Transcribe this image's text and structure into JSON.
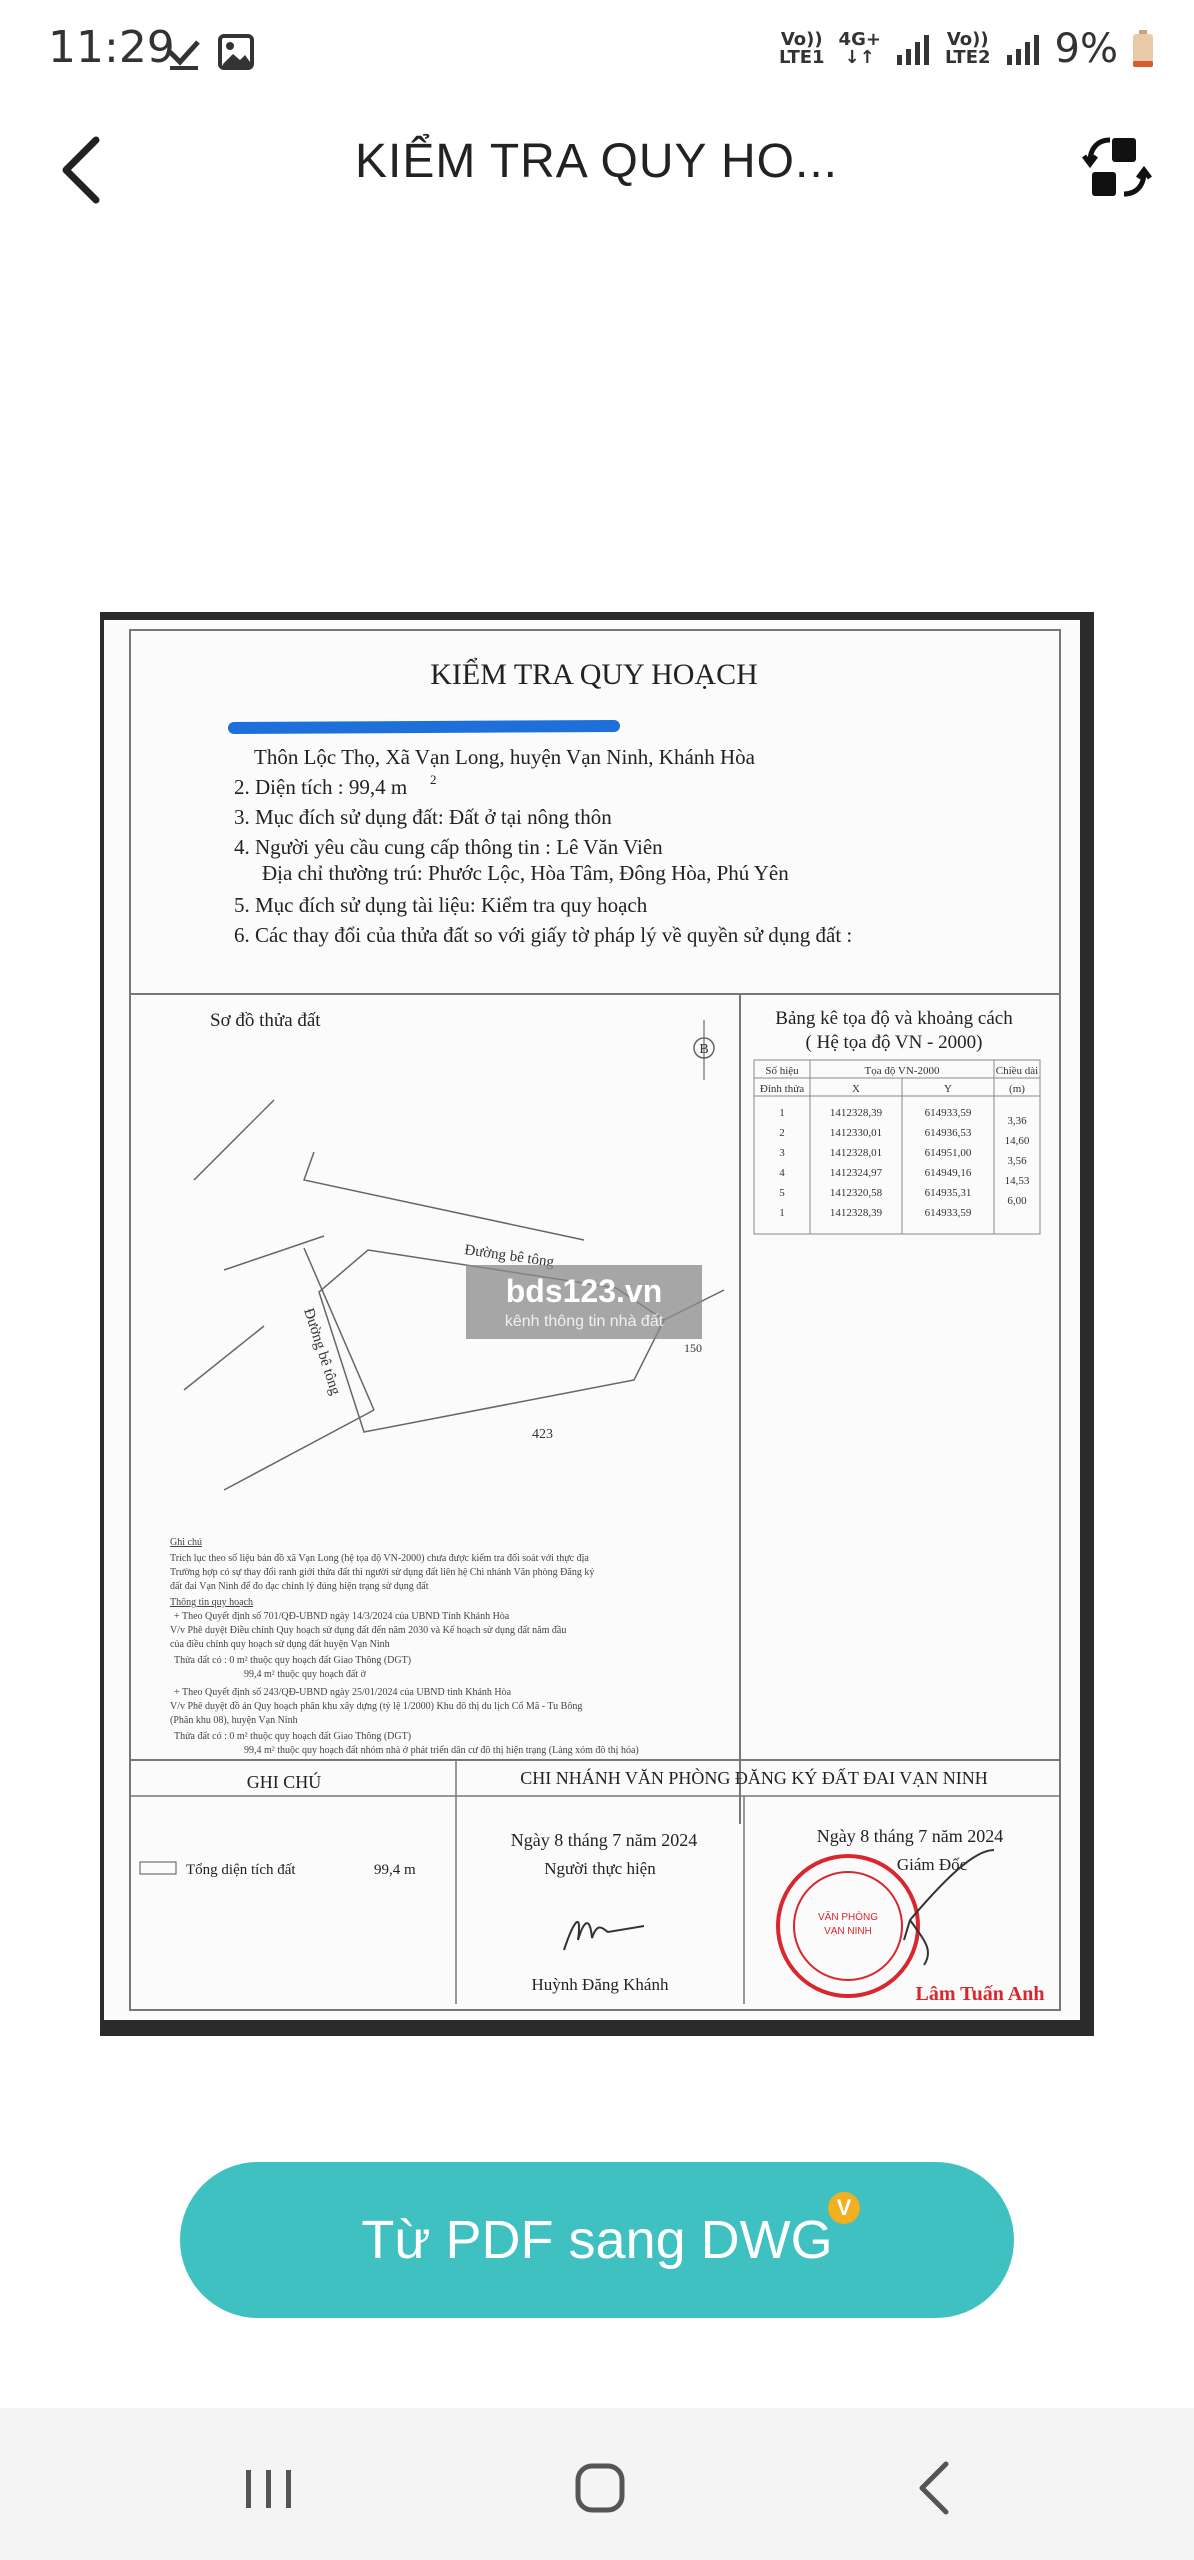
{
  "status_bar": {
    "time": "11:29",
    "net1_top": "Vo))",
    "net1_bottom": "LTE1",
    "net_4g_top": "4G+",
    "net_4g_bottom": "↓↑",
    "net2_top": "Vo))",
    "net2_bottom": "LTE2",
    "battery": "9%"
  },
  "app_bar": {
    "title": "KIỂM TRA QUY HO...",
    "back_icon": "arrow-left",
    "swap_icon": "convert-swap"
  },
  "document": {
    "heading": "KIỂM TRA QUY HOẠCH",
    "lines": [
      "Thôn Lộc Thọ, Xã Vạn Long, huyện Vạn Ninh, Khánh Hòa",
      "2. Diện tích :  99,4 m",
      "3. Mục đích sử dụng đất:  Đất ở tại nông thôn",
      "4. Người yêu cầu cung cấp thông tin : Lê Văn Viên",
      "Địa chỉ thường trú: Phước Lộc, Hòa Tâm, Đông Hòa, Phú Yên",
      "5. Mục đích sử dụng tài liệu: Kiểm tra quy hoạch",
      "6. Các thay đổi của thửa đất so với giấy tờ pháp lý về quyền sử dụng đất :"
    ],
    "area_superscript": "2",
    "map_title": "Sơ đồ thửa đất",
    "north_label": "B",
    "road_label_1": "Đường bê tông",
    "road_label_2": "Đường bê tông",
    "parcel_label": "423",
    "parcel_label_2": "150",
    "watermark_main": "bds123.vn",
    "watermark_sub": "kênh thông tin nhà đất",
    "table_title_1": "Bảng kê tọa độ và khoảng cách",
    "table_title_2": "( Hệ tọa độ VN - 2000)",
    "table_headers": [
      "Số hiệu",
      "Tọa độ VN-2000",
      "Chiều dài",
      "Đỉnh thửa",
      "X",
      "Y",
      "(m)"
    ],
    "table_rows": [
      [
        "1",
        "1412328,39",
        "614933,59",
        "3,36"
      ],
      [
        "2",
        "1412330,01",
        "614936,53",
        "14,60"
      ],
      [
        "3",
        "1412328,01",
        "614951,00",
        "3,56"
      ],
      [
        "4",
        "1412324,97",
        "614949,16",
        "14,53"
      ],
      [
        "5",
        "1412320,58",
        "614935,31",
        "6,00"
      ],
      [
        "1",
        "1412328,39",
        "614933,59",
        ""
      ]
    ],
    "notes": [
      "Ghi chú",
      "Trích lục theo số liệu bản đồ xã Vạn Long (hệ tọa độ VN-2000) chưa được kiểm tra đối soát với thực địa",
      "Trường hợp có sự thay đổi ranh giới thửa đất thì người sử dụng đất liên hệ Chi nhánh Văn phòng Đăng ký",
      "đất đai Vạn Ninh để đo đạc chỉnh lý đúng hiện trạng sử dụng đất",
      "Thông tin quy hoạch",
      "+ Theo Quyết định số  701/QĐ-UBND ngày 14/3/2024 của UBND Tỉnh Khánh Hòa",
      "V/v Phê duyệt Điều chỉnh Quy hoạch sử dụng đất đến năm 2030 và Kế hoạch sử dụng đất năm đầu",
      "của điều chỉnh quy hoạch sử dụng đất huyện Vạn Ninh",
      "Thửa đất có :      0 m² thuộc quy hoạch đất Giao Thông  (DGT)",
      "99,4 m²  thuộc quy hoạch đất ở",
      "+ Theo Quyết định số  243/QĐ-UBND ngày 25/01/2024 của UBND tỉnh Khánh Hòa",
      "V/v Phê duyệt đồ án Quy hoạch phân khu xây dựng (tỷ lệ 1/2000) Khu đô thị du lịch Cổ Mã - Tu Bông",
      "(Phân khu 08), huyện Vạn Ninh",
      "Thửa đất có :      0 m² thuộc quy hoạch đất Giao Thông  (DGT)",
      "99,4 m²  thuộc quy hoạch đất nhóm nhà ở phát triển dân cư đô thị hiện trạng (Làng xóm đô thị hóa)"
    ],
    "ghi_chu_label": "GHI CHÚ",
    "office_header": "CHI NHÁNH VĂN PHÒNG ĐĂNG KÝ ĐẤT ĐAI VẠN NINH",
    "total_area_label": "Tổng diện tích đất",
    "total_area_value": "99,4 m",
    "date_left": "Ngày  8  tháng  7  năm  2024",
    "role_left": "Người thực hiện",
    "name_left": "Huỳnh Đăng Khánh",
    "date_right": "Ngày  8  tháng  7  năm  2024",
    "role_right": "Giám Đốc",
    "name_right": "Lâm Tuấn Anh",
    "stamp_text": "CHI NHÁNH VĂN PHÒNG ĐĂNG KÝ ĐẤT ĐAI TẠI HUYỆN VẠN NINH"
  },
  "cta": {
    "label": "Từ PDF sang DWG",
    "badge": "V"
  },
  "nav_bar": {
    "recents_icon": "recents",
    "home_icon": "home",
    "back_icon": "back"
  },
  "colors": {
    "accent": "#3fc1c2",
    "badge": "#f2b020",
    "stamp": "#d9272e",
    "highlight": "#1e6fd9"
  }
}
